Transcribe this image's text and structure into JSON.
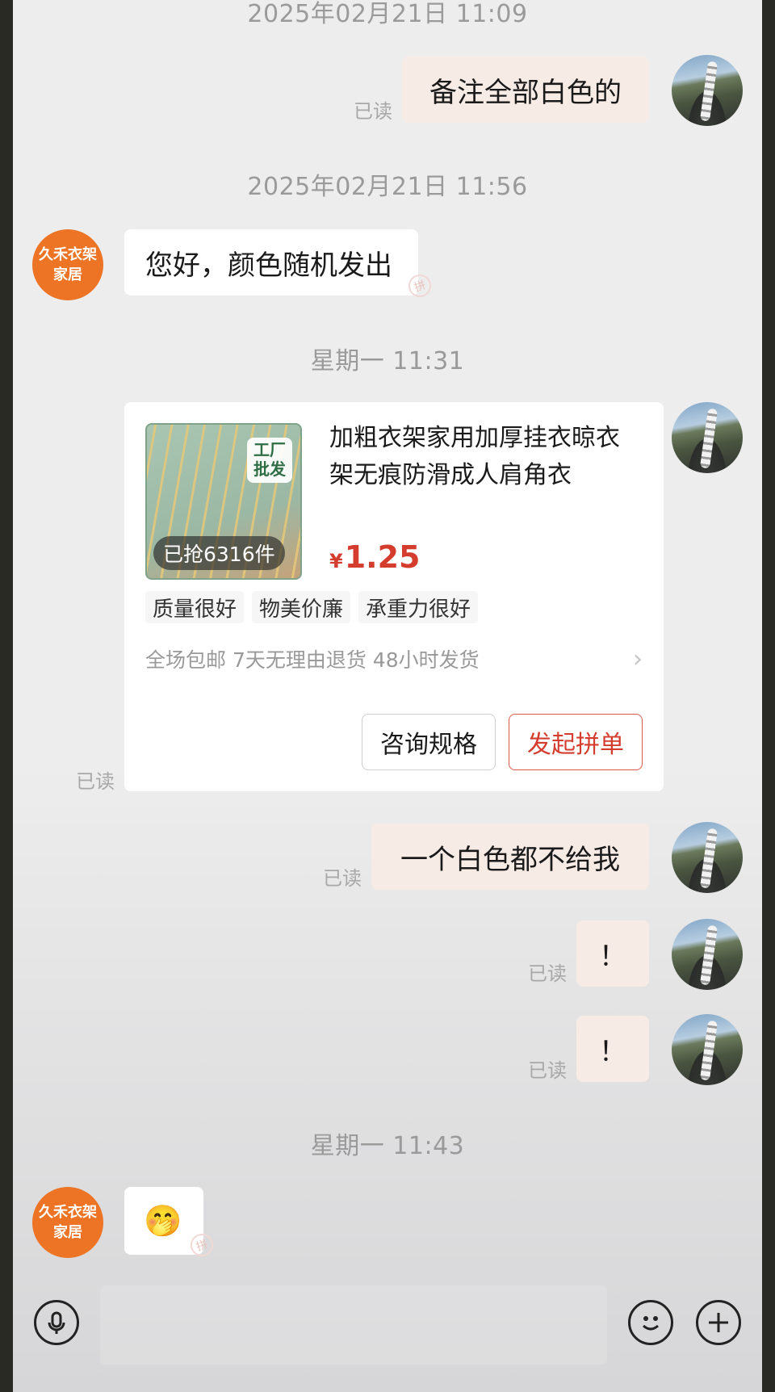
{
  "messages": {
    "ts1": "2025年02月21日 11:09",
    "msg1": "备注全部白色的",
    "ts2": "2025年02月21日 11:56",
    "msg2": "您好，颜色随机发出",
    "ts3": "星期一 11:31",
    "msg4": "一个白色都不给我",
    "msg5": "！",
    "msg6": "！",
    "ts4": "星期一 11:43",
    "msg7_emoji": "🤭"
  },
  "read_label": "已读",
  "shop": {
    "avatar_line1": "久禾衣架",
    "avatar_line2": "家居"
  },
  "pin_icon_text": "拼",
  "product": {
    "title": "加粗衣架家用加厚挂衣晾衣架无痕防滑成人肩角衣",
    "badge_line1": "工厂",
    "badge_line2": "批发",
    "sold": "已抢6316件",
    "currency": "¥",
    "price": "1.25",
    "tags": [
      "质量很好",
      "物美价廉",
      "承重力很好"
    ],
    "services": "全场包邮 7天无理由退货 48小时发货",
    "consult_button": "咨询规格",
    "group_button": "发起拼单"
  },
  "icons": {
    "mic": "microphone-icon",
    "emoji": "smiley-icon",
    "plus": "plus-icon"
  }
}
